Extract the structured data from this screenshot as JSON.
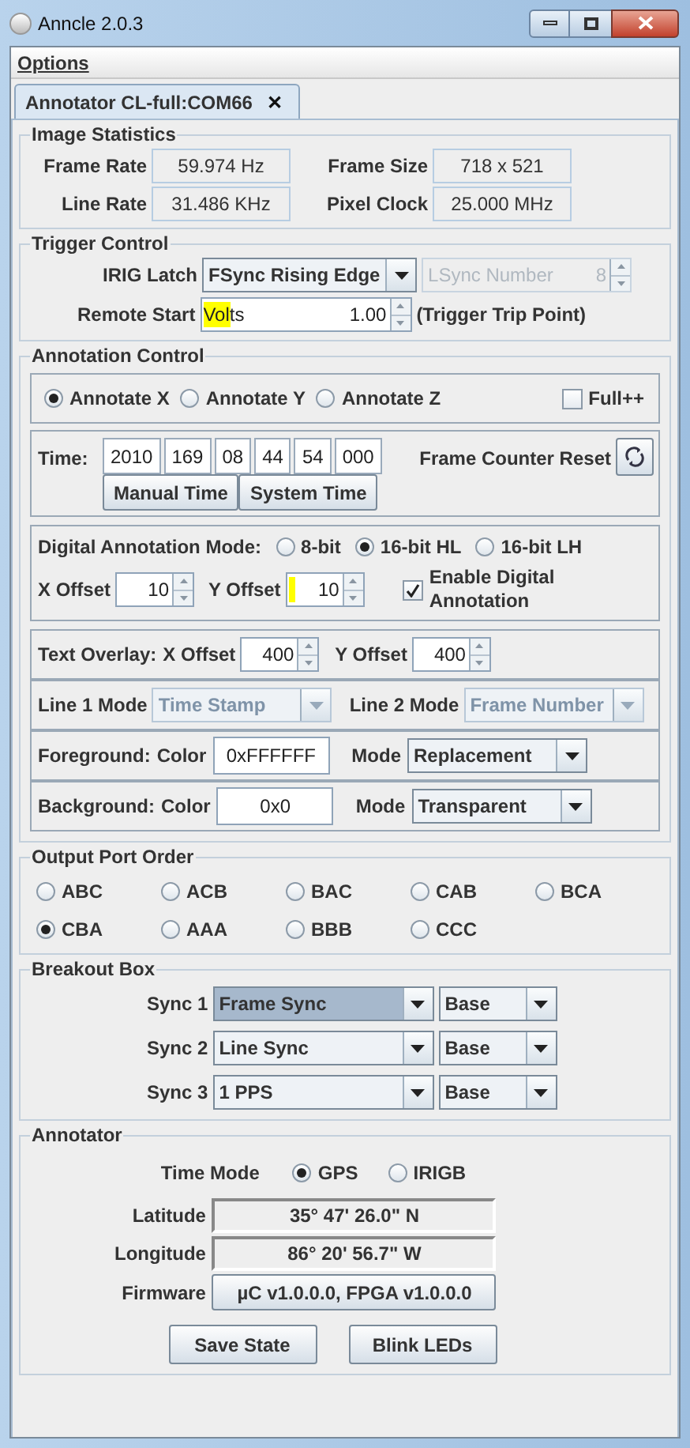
{
  "window": {
    "title": "Anncle 2.0.3"
  },
  "menu": [
    {
      "label": "Options"
    }
  ],
  "tabs": [
    {
      "label": "Annotator CL-full:COM66",
      "selected": true,
      "close": "✕"
    }
  ],
  "image_statistics": {
    "title": "Image Statistics",
    "fields": [
      {
        "label": "Frame Rate",
        "value": "59.974 Hz"
      },
      {
        "label": "Frame Size",
        "value": "718 x 521"
      },
      {
        "label": "Line Rate",
        "value": "31.486 KHz"
      },
      {
        "label": "Pixel Clock",
        "value": "25.000 MHz"
      }
    ]
  },
  "trigger_control": {
    "title": "Trigger Control",
    "irig_latch": {
      "label": "IRIG Latch",
      "value": "FSync Rising Edge"
    },
    "lsync": {
      "label": "LSync Number",
      "value": "8",
      "disabled": true
    },
    "remote_start": {
      "label": "Remote Start",
      "unit": "Volts",
      "value": "1.00",
      "highlight": true,
      "note": "(Trigger Trip Point)"
    }
  },
  "annotation_control": {
    "title": "Annotation Control",
    "axes": [
      {
        "label": "Annotate X",
        "selected": true
      },
      {
        "label": "Annotate Y",
        "selected": false
      },
      {
        "label": "Annotate Z",
        "selected": false
      }
    ],
    "full": {
      "label": "Full++",
      "checked": false
    },
    "time": {
      "label": "Time:",
      "fields": [
        "2010",
        "169",
        "08",
        "44",
        "54",
        "000"
      ],
      "buttons": [
        "Manual Time",
        "System Time"
      ],
      "reset_label": "Frame Counter Reset"
    },
    "digital": {
      "label": "Digital Annotation Mode:",
      "modes": [
        {
          "label": "8-bit",
          "selected": false
        },
        {
          "label": "16-bit HL",
          "selected": true
        },
        {
          "label": "16-bit LH",
          "selected": false
        }
      ],
      "x_offset": {
        "label": "X Offset",
        "value": "10"
      },
      "y_offset": {
        "label": "Y Offset",
        "value": "10",
        "highlight": true
      },
      "enable": {
        "label": "Enable Digital Annotation",
        "checked": true
      }
    },
    "text_overlay": {
      "label": "Text Overlay:",
      "x_offset": {
        "label": "X Offset",
        "value": "400"
      },
      "y_offset": {
        "label": "Y Offset",
        "value": "400"
      }
    },
    "line_modes": [
      {
        "label": "Line 1 Mode",
        "value": "Time Stamp",
        "disabled": true
      },
      {
        "label": "Line 2 Mode",
        "value": "Frame Number",
        "disabled": true
      }
    ],
    "colors": [
      {
        "label": "Foreground:",
        "color_label": "Color",
        "value": "0xFFFFFF",
        "mode_label": "Mode",
        "mode": "Replacement"
      },
      {
        "label": "Background:",
        "color_label": "Color",
        "value": "0x0",
        "mode_label": "Mode",
        "mode": "Transparent"
      }
    ]
  },
  "output_port_order": {
    "title": "Output Port Order",
    "options": [
      {
        "label": "ABC",
        "selected": false
      },
      {
        "label": "ACB",
        "selected": false
      },
      {
        "label": "BAC",
        "selected": false
      },
      {
        "label": "CAB",
        "selected": false
      },
      {
        "label": "BCA",
        "selected": false
      },
      {
        "label": "CBA",
        "selected": true
      },
      {
        "label": "AAA",
        "selected": false
      },
      {
        "label": "BBB",
        "selected": false
      },
      {
        "label": "CCC",
        "selected": false
      }
    ]
  },
  "breakout_box": {
    "title": "Breakout Box",
    "rows": [
      {
        "label": "Sync 1",
        "signal": "Frame Sync",
        "focused": true,
        "base": "Base"
      },
      {
        "label": "Sync 2",
        "signal": "Line Sync",
        "focused": false,
        "base": "Base"
      },
      {
        "label": "Sync 3",
        "signal": "1 PPS",
        "focused": false,
        "base": "Base"
      }
    ]
  },
  "annotator": {
    "title": "Annotator",
    "time_mode": {
      "label": "Time Mode",
      "options": [
        {
          "label": "GPS",
          "selected": true
        },
        {
          "label": "IRIGB",
          "selected": false
        }
      ]
    },
    "latitude": {
      "label": "Latitude",
      "value": "35° 47' 26.0\" N"
    },
    "longitude": {
      "label": "Longitude",
      "value": "86° 20' 56.7\" W"
    },
    "firmware": {
      "label": "Firmware",
      "value": "µC v1.0.0.0, FPGA v1.0.0.0"
    },
    "buttons": [
      "Save State",
      "Blink LEDs"
    ]
  }
}
